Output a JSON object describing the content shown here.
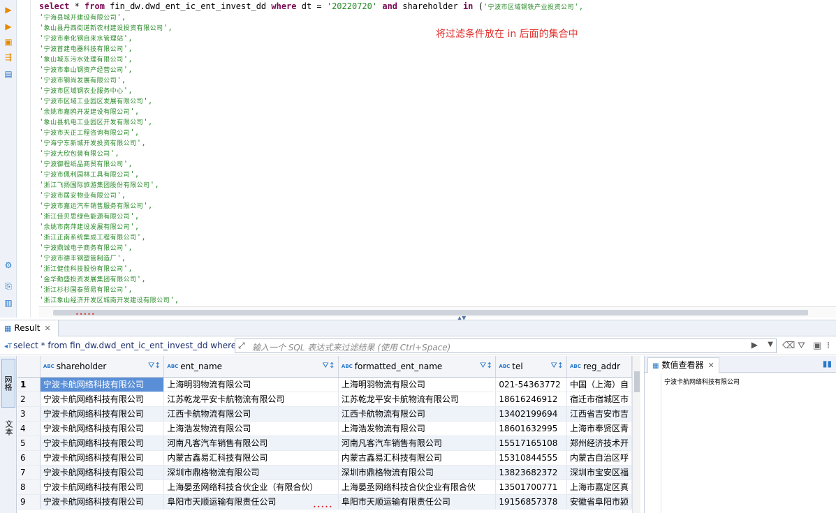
{
  "editor": {
    "sql_line": [
      "select",
      " * ",
      "from",
      " fin_dw.dwd_ent_ic_ent_invest_dd ",
      "where",
      " dt = ",
      "'20220720'",
      " ",
      "and",
      " shareholder ",
      "in",
      " (",
      "'",
      "宁波市区域钢铁产业投资公司",
      "',"
    ],
    "list_items": [
      "宁海县城开建设有限公司",
      "象山县丹西街道新农村建设投资有限公司",
      "宁波市奉化钢自来水管理站",
      "宁波首建电器科技有限公司",
      "象山城东污水处理有限公司",
      "宁波市奉山钢资产经营公司",
      "宁波市钢尚发展有限公司",
      "宁波市区域钢农业服务中心",
      "宁波市区域工业园区发展有限公司",
      "余姚市嘉鸥开发建设有限公司",
      "象山县机电工业园区开发有限公司",
      "宁波市天正工程咨询有限公司",
      "宁海宁东新城开发投资有限公司",
      "宁波大欣包装有限公司",
      "宁波御程纸品商贸有限公司",
      "宁波市佩利园林工具有限公司",
      "浙江飞扬国际旅游集团股份有限公司",
      "宁波市居安物业有限公司",
      "宁波市嘉运汽车销售服务有限公司",
      "浙江佳贝思绿色能源有限公司",
      "余姚市南萍建设发展有限公司",
      "浙江正南系统集成工程有限公司",
      "宁波鼎诚电子商务有限公司",
      "宁波市德丰钢塑管制造厂",
      "浙江健佳科技股份有限公司",
      "金华勤盛投资发展集团有限公司",
      "浙江杉杉国泰贸易有限公司",
      "浙江象山经济开发区城南开发建设有限公司"
    ],
    "annotation": "将过滤条件放在 in 后面的集合中"
  },
  "result_tab": {
    "label": "Result"
  },
  "filter": {
    "query": "select * from fin_dw.dwd_ent_ic_ent_invest_dd where",
    "placeholder": "输入一个 SQL 表达式来过滤结果 (使用 Ctrl+Space)"
  },
  "side_tabs": {
    "grid": "网格",
    "text": "文本"
  },
  "grid": {
    "columns": [
      "shareholder",
      "ent_name",
      "formatted_ent_name",
      "tel",
      "reg_addr"
    ],
    "rows": [
      [
        "1",
        "宁波卡航网络科技有限公司",
        "上海明羽物流有限公司",
        "上海明羽物流有限公司",
        "021-54363772",
        "中国（上海）自"
      ],
      [
        "2",
        "宁波卡航网络科技有限公司",
        "江苏乾龙平安卡航物流有限公司",
        "江苏乾龙平安卡航物流有限公司",
        "18616246912",
        "宿迁市宿城区市"
      ],
      [
        "3",
        "宁波卡航网络科技有限公司",
        "江西卡航物流有限公司",
        "江西卡航物流有限公司",
        "13402199694",
        "江西省吉安市吉"
      ],
      [
        "4",
        "宁波卡航网络科技有限公司",
        "上海浩发物流有限公司",
        "上海浩发物流有限公司",
        "18601632995",
        "上海市奉贤区青"
      ],
      [
        "5",
        "宁波卡航网络科技有限公司",
        "河南凡客汽车销售有限公司",
        "河南凡客汽车销售有限公司",
        "15517165108",
        "郑州经济技术开"
      ],
      [
        "6",
        "宁波卡航网络科技有限公司",
        "内蒙古鑫易汇科技有限公司",
        "内蒙古鑫易汇科技有限公司",
        "15310844555",
        "内蒙古自治区呼"
      ],
      [
        "7",
        "宁波卡航网络科技有限公司",
        "深圳市鼎格物流有限公司",
        "深圳市鼎格物流有限公司",
        "13823682372",
        "深圳市宝安区福"
      ],
      [
        "8",
        "宁波卡航网络科技有限公司",
        "上海晏丞网络科技合伙企业（有限合伙）",
        "上海晏丞网络科技合伙企业有限合伙",
        "13501700771",
        "上海市嘉定区真"
      ],
      [
        "9",
        "宁波卡航网络科技有限公司",
        "阜阳市天顺运输有限责任公司",
        "阜阳市天顺运输有限责任公司",
        "19156857378",
        "安徽省阜阳市颍"
      ]
    ]
  },
  "value_viewer": {
    "title": "数值查看器",
    "value": "宁波卡航网络科技有限公司"
  },
  "colors": {
    "keyword": "#7a0a55",
    "string": "#2a8a2a",
    "annotation": "#e0312d",
    "selection": "#5a8fd8"
  }
}
